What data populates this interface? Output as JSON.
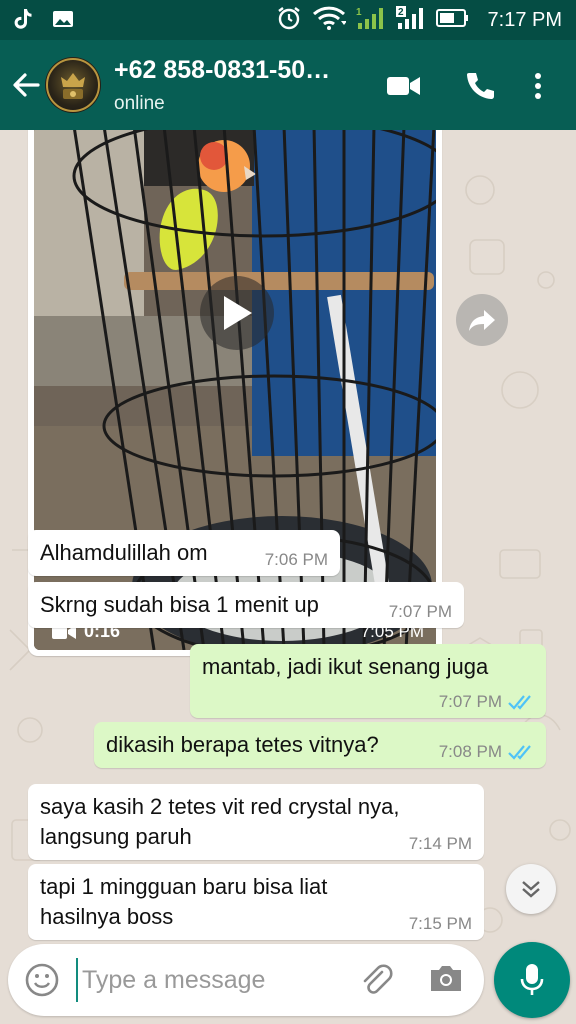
{
  "status_bar": {
    "time": "7:17 PM",
    "icons": [
      "tiktok-icon",
      "gallery-icon",
      "alarm-icon",
      "wifi-icon",
      "signal-1-icon",
      "signal-2-icon",
      "battery-icon"
    ]
  },
  "header": {
    "contact_name": "+62 858-0831-50…",
    "contact_status": "online",
    "icons": [
      "back-arrow-icon",
      "video-call-icon",
      "voice-call-icon",
      "more-vert-icon"
    ]
  },
  "video_message": {
    "duration": "0:16",
    "time": "7:05 PM"
  },
  "messages": [
    {
      "direction": "in",
      "text": "Alhamdulillah om",
      "time": "7:06 PM"
    },
    {
      "direction": "in",
      "text": "Skrng sudah bisa 1 menit up",
      "time": "7:07 PM"
    },
    {
      "direction": "out",
      "text": "mantab, jadi ikut senang juga",
      "time": "7:07 PM",
      "status": "read"
    },
    {
      "direction": "out",
      "text": "dikasih berapa tetes vitnya?",
      "time": "7:08 PM",
      "status": "read"
    },
    {
      "direction": "in",
      "text": "saya kasih 2 tetes vit red crystal nya, langsung paruh",
      "time": "7:14 PM"
    },
    {
      "direction": "in",
      "text": "tapi 1 mingguan baru bisa liat hasilnya boss",
      "time": "7:15 PM"
    }
  ],
  "composer": {
    "placeholder": "Type a message"
  },
  "colors": {
    "status_bar": "#054d44",
    "app_bar": "#075e54",
    "outgoing_bubble": "#dcf8c6",
    "incoming_bubble": "#ffffff",
    "chat_background": "#e5ddd5",
    "read_ticks": "#4fc3f7",
    "mic_button": "#00897b"
  }
}
